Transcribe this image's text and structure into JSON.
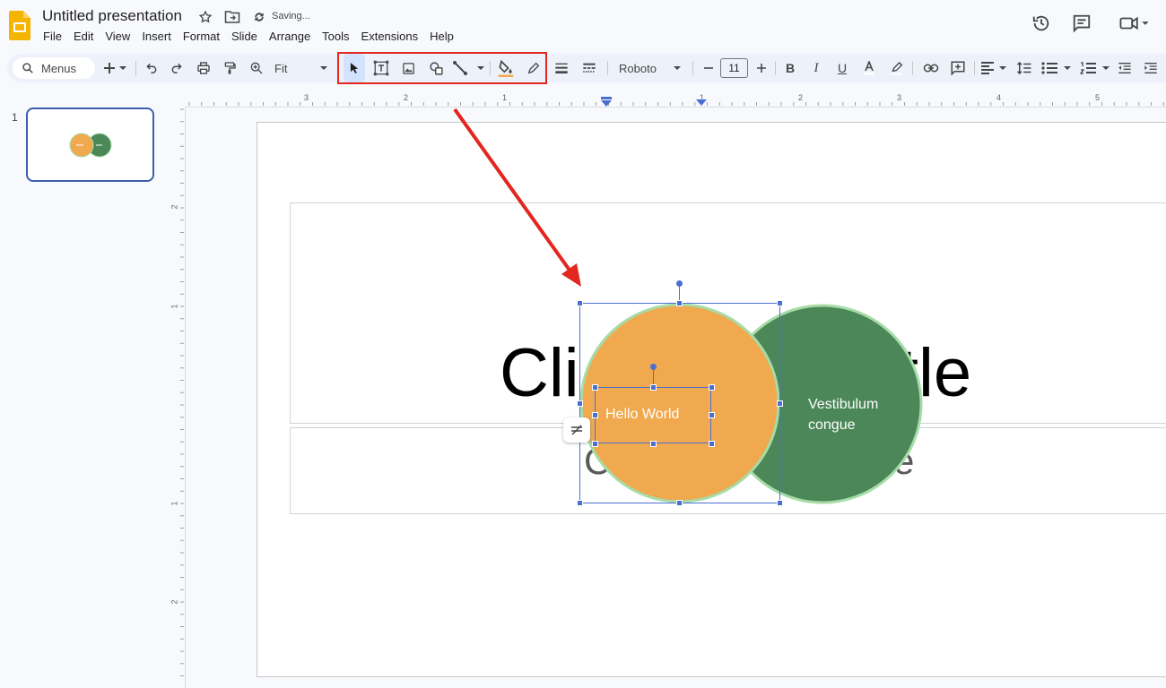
{
  "app": {
    "doc_title": "Untitled presentation",
    "save_status": "Saving...",
    "icons": [
      "star-icon",
      "move-to-folder-icon",
      "cloud-sync-icon",
      "version-history-icon",
      "comments-icon",
      "meet-camera-icon"
    ]
  },
  "menubar": {
    "items": [
      "File",
      "Edit",
      "View",
      "Insert",
      "Format",
      "Slide",
      "Arrange",
      "Tools",
      "Extensions",
      "Help"
    ]
  },
  "toolbar": {
    "search_label": "Menus",
    "zoom_value": "Fit",
    "font_name": "Roboto",
    "font_size": "11",
    "highlighted_group": [
      "select-icon",
      "text-box-icon",
      "image-icon",
      "shape-icon",
      "line-icon",
      "fill-color-icon",
      "border-color-icon"
    ],
    "highlight_color": "#e3261e"
  },
  "ruler": {
    "horizontal_ticks": [
      "3",
      "2",
      "1",
      "1",
      "2",
      "3",
      "4",
      "5"
    ],
    "vertical_ticks": [
      "2",
      "1",
      "1",
      "2"
    ]
  },
  "filmstrip": {
    "slides": [
      {
        "number": "1"
      }
    ]
  },
  "slide": {
    "title_placeholder": "Click to add title",
    "title_visible_left": "Cli",
    "title_visible_right": "itle",
    "subtitle_visible_left": "C",
    "subtitle_visible_right": "e",
    "shapes": [
      {
        "name": "orange-circle",
        "fill": "#f0a94e",
        "outline": "#a7dca7",
        "text": "Hello World"
      },
      {
        "name": "green-circle",
        "fill": "#4c8759",
        "outline": "#a7dca7",
        "text_line1": "Vestibulum",
        "text_line2": "congue"
      }
    ],
    "selection_color": "#4a6fd0"
  },
  "annotation": {
    "arrow_color": "#e3261e"
  }
}
